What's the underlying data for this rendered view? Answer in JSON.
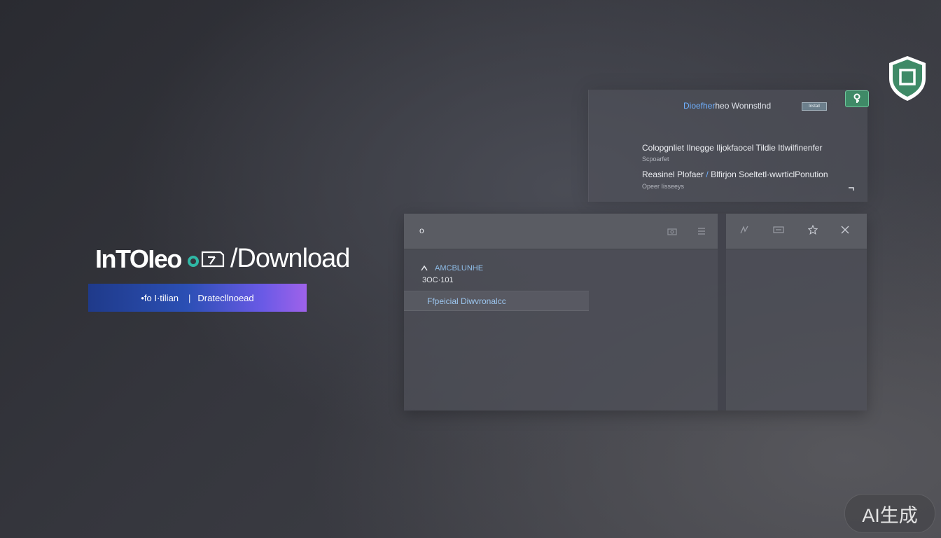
{
  "brand": {
    "name": "InTOIeo",
    "tail": "/Download",
    "cta_left": "•fo I·tilian",
    "cta_sep": "|",
    "cta_right": "Dratecllnoead"
  },
  "top_panel": {
    "title_accent": "Dioefher",
    "title_rest": "heo Wonnstlnd",
    "badge": "Install",
    "line1": "Colopgnliet Ilnegge Iljokfaocel Tildie Itlwilfinenfer",
    "line1_sub": "Scpoarfet",
    "line2_a": "Reasinel Plofaer",
    "line2_slash": "/",
    "line2_b": "Blfirjon Soeltetl·wwrticlPonution",
    "line2_sub": "Opeer Iisseeys"
  },
  "main_panel": {
    "toolbar_text": "o",
    "list": [
      {
        "title": "AMCBLUNHE",
        "sub": "3OC·101"
      },
      {
        "title": "Ffpeicial Diwvronalcc"
      }
    ]
  },
  "watermark": "AI生成",
  "colors": {
    "accent": "#6fb0ff",
    "shield": "#3f8a67",
    "cta_start": "#1f3a8a",
    "cta_end": "#9f62ea"
  },
  "icons": [
    "shield-icon",
    "key-icon",
    "camera-icon",
    "list-icon",
    "grid-icon",
    "layers-icon",
    "star-icon",
    "close-icon",
    "download-icon",
    "sort-icon"
  ]
}
